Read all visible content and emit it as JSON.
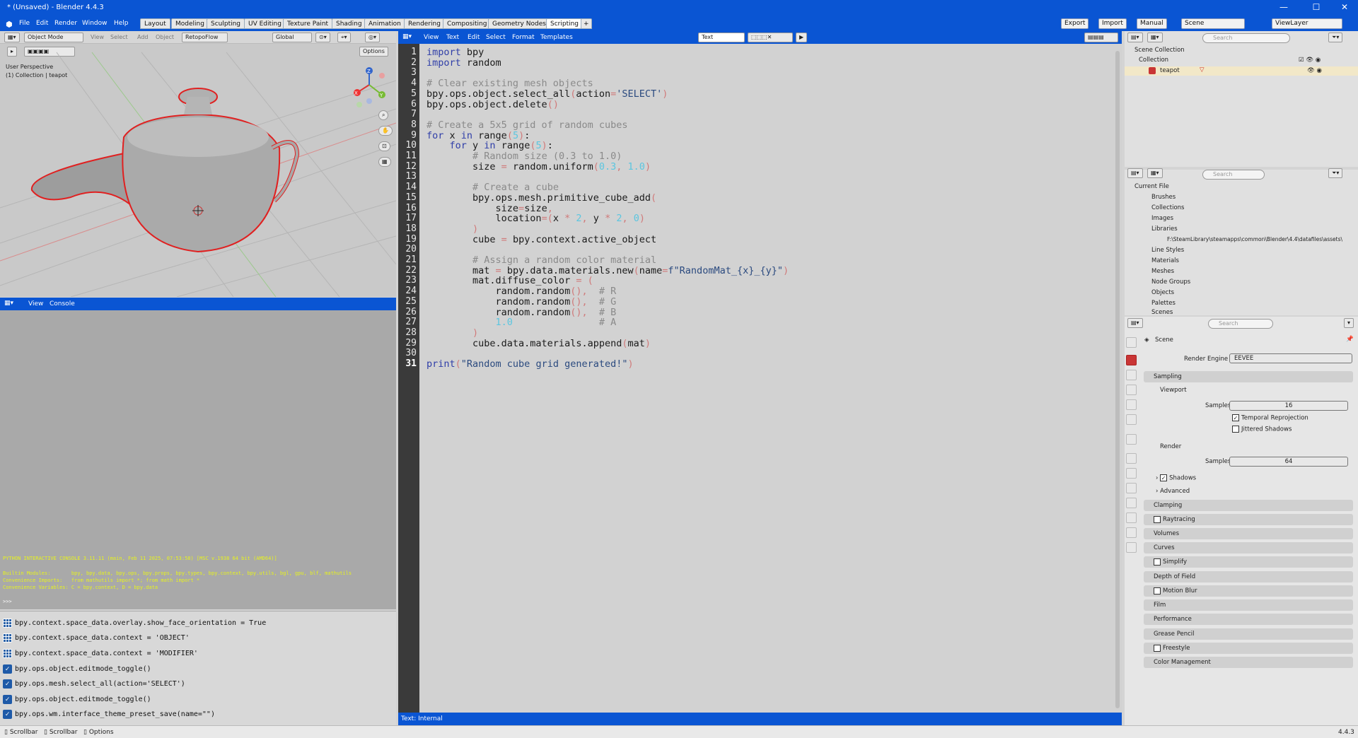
{
  "window": {
    "title": "* (Unsaved) - Blender 4.4.3",
    "controls": [
      "—",
      "☐",
      "✕"
    ]
  },
  "menus": [
    "File",
    "Edit",
    "Render",
    "Window",
    "Help"
  ],
  "workspaces": [
    "Layout",
    "Modeling",
    "Sculpting",
    "UV Editing",
    "Texture Paint",
    "Shading",
    "Animation",
    "Rendering",
    "Compositing",
    "Geometry Nodes",
    "Scripting"
  ],
  "active_workspace": "Scripting",
  "topright": {
    "export": "Export",
    "import": "Import",
    "manual": "Manual",
    "scene": "Scene",
    "viewlayer": "ViewLayer"
  },
  "viewport": {
    "mode": "Object Mode",
    "menus": [
      "View",
      "Select",
      "Add",
      "Object"
    ],
    "snapping": "RetopoFlow",
    "orientation": "Global",
    "options": "Options",
    "info1": "User Perspective",
    "info2": "(1) Collection | teapot",
    "axes": [
      "X",
      "Y",
      "Z"
    ]
  },
  "console": {
    "menus": [
      "View",
      "Console"
    ],
    "lines": [
      "PYTHON INTERACTIVE CONSOLE 3.11.11 (main, Feb 11 2025, 07:53:58) [MSC v.1938 64 bit (AMD64)]",
      "",
      "Builtin Modules:       bpy, bpy.data, bpy.ops, bpy.props, bpy.types, bpy.context, bpy.utils, bgl, gpu, blf, mathutils",
      "Convenience Imports:   from mathutils import *; from math import *",
      "Convenience Variables: C = bpy.context, D = bpy.data",
      "",
      ">>> "
    ]
  },
  "info_log": [
    {
      "icon": "grid",
      "text": "bpy.context.space_data.overlay.show_face_orientation = True"
    },
    {
      "icon": "grid",
      "text": "bpy.context.space_data.context = 'OBJECT'"
    },
    {
      "icon": "grid",
      "text": "bpy.context.space_data.context = 'MODIFIER'"
    },
    {
      "icon": "check",
      "text": "bpy.ops.object.editmode_toggle()"
    },
    {
      "icon": "check",
      "text": "bpy.ops.mesh.select_all(action='SELECT')"
    },
    {
      "icon": "check",
      "text": "bpy.ops.object.editmode_toggle()"
    },
    {
      "icon": "check",
      "text": "bpy.ops.wm.interface_theme_preset_save(name=\"\")"
    }
  ],
  "text_editor": {
    "menus": [
      "View",
      "Text",
      "Edit",
      "Select",
      "Format",
      "Templates"
    ],
    "datablock": "Text",
    "footer": "Text: Internal",
    "current_line": 31,
    "lines": [
      "import bpy",
      "import random",
      "",
      "# Clear existing mesh objects",
      "bpy.ops.object.select_all(action='SELECT')",
      "bpy.ops.object.delete()",
      "",
      "# Create a 5x5 grid of random cubes",
      "for x in range(5):",
      "    for y in range(5):",
      "        # Random size (0.3 to 1.0)",
      "        size = random.uniform(0.3, 1.0)",
      "",
      "        # Create a cube",
      "        bpy.ops.mesh.primitive_cube_add(",
      "            size=size,",
      "            location=(x * 2, y * 2, 0)",
      "        )",
      "        cube = bpy.context.active_object",
      "",
      "        # Assign a random color material",
      "        mat = bpy.data.materials.new(name=f\"RandomMat_{x}_{y}\")",
      "        mat.diffuse_color = (",
      "            random.random(),  # R",
      "            random.random(),  # G",
      "            random.random(),  # B",
      "            1.0               # A",
      "        )",
      "        cube.data.materials.append(mat)",
      "",
      "print(\"Random cube grid generated!\")"
    ]
  },
  "outliner": {
    "search": "Search",
    "scene_collection": "Scene Collection",
    "collection": "Collection",
    "object": "teapot"
  },
  "data_api": {
    "search": "Search",
    "root": "Current File",
    "items": [
      "Brushes",
      "Collections",
      "Images",
      "Libraries",
      "Line Styles",
      "Materials",
      "Meshes",
      "Node Groups",
      "Objects",
      "Palettes",
      "Scenes"
    ],
    "library_path": "F:\\SteamLibrary\\steamapps\\common\\Blender\\4.4\\datafiles\\assets\\"
  },
  "properties": {
    "search": "Search",
    "scene": "Scene",
    "render_engine_label": "Render Engine",
    "render_engine": "EEVEE",
    "sampling": "Sampling",
    "viewport": "Viewport",
    "samples_label": "Samples",
    "viewport_samples": "16",
    "temporal": "Temporal Reprojection",
    "jittered": "Jittered Shadows",
    "render": "Render",
    "render_samples": "64",
    "shadows": "Shadows",
    "advanced": "Advanced",
    "panels": [
      "Clamping",
      "Raytracing",
      "Volumes",
      "Curves",
      "Simplify",
      "Depth of Field",
      "Motion Blur",
      "Film",
      "Performance",
      "Grease Pencil",
      "Freestyle",
      "Color Management"
    ]
  },
  "statusbar": {
    "items": [
      "Scrollbar",
      "Scrollbar",
      "Options"
    ],
    "version": "4.4.3"
  }
}
